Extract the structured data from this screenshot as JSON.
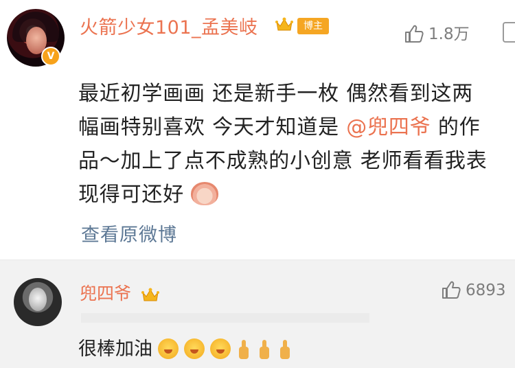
{
  "comment": {
    "author": "火箭少女101_孟美岐",
    "owner_badge": "博主",
    "verified_mark": "V",
    "likes": "1.8万",
    "text_lines": [
      "最近初学画画 还是新手一枚 偶然看到这两",
      "幅画特别喜欢 今天才知道是 ",
      "品～加上了点不成熟的小创意 老师看看我表",
      "现得可还好"
    ],
    "mention": "@兜四爷",
    "mention_after": " 的作",
    "view_original": "查看原微博"
  },
  "reply": {
    "author": "兜四爷",
    "likes": "6893",
    "text": "很棒加油"
  },
  "colors": {
    "name": "#eb7350",
    "link": "#5d7895",
    "badge": "#f5a623",
    "reply_bg": "#f2f2f2"
  },
  "icons": [
    "avatar",
    "verified-v-icon",
    "vip-crown-icon",
    "thumbs-up-icon",
    "more-icon",
    "emoji-bun-icon",
    "emoji-face-icon",
    "emoji-thumb-icon"
  ]
}
